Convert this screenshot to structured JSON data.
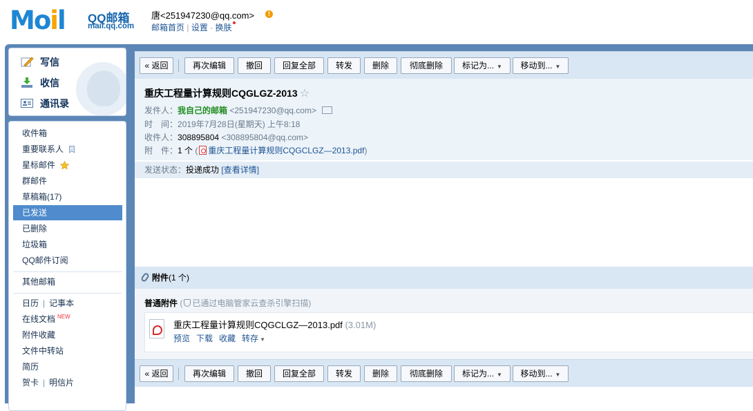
{
  "header": {
    "logo_text_m": "M",
    "logo_text_o": "o",
    "logo_text_i": "i",
    "logo_text_l": "l",
    "logo_cn": "QQ邮箱",
    "logo_url": "mail.qq.com",
    "user_display": "唐<251947230@qq.com>",
    "warn_symbol": "!",
    "links": {
      "home": "邮箱首页",
      "settings": "设置",
      "skin": "换肤"
    },
    "link_sep": "|",
    "link_dash": "-"
  },
  "sidebar": {
    "commands": {
      "compose": "写信",
      "inbox": "收信",
      "contacts": "通讯录"
    },
    "folders": {
      "inbox": "收件箱",
      "important": "重要联系人",
      "starred": "星标邮件",
      "group": "群邮件",
      "drafts": "草稿箱(17)",
      "sent": "已发送",
      "deleted": "已删除",
      "junk": "垃圾箱",
      "subscriptions": "QQ邮件订阅",
      "other_mail": "其他邮箱",
      "calendar": "日历",
      "notes": "记事本",
      "docs": "在线文档",
      "docs_badge": "NEW",
      "attach_fav": "附件收藏",
      "transfer": "文件中转站",
      "resume": "简历",
      "cards": "贺卡",
      "postcards": "明信片",
      "pipe": "|",
      "selected": "已发送"
    }
  },
  "toolbar": {
    "back": "« 返回",
    "reedit": "再次编辑",
    "recall": "撤回",
    "reply_all": "回复全部",
    "forward": "转发",
    "delete": "删除",
    "delete_perm": "彻底删除",
    "mark_as": "标记为...",
    "move_to": "移动到...",
    "dropdown_arrow": "▼"
  },
  "mail": {
    "subject": "重庆工程量计算规则CQGLGZ-2013",
    "star_glyph": "☆",
    "from_label": "发件人：",
    "from_name": "我自己的邮箱",
    "from_addr": "<251947230@qq.com>",
    "time_label": "时　间：",
    "time_value": "2019年7月28日(星期天) 上午8:18",
    "to_label": "收件人：",
    "to_name": "308895804",
    "to_addr": "<308895804@qq.com>",
    "att_label": "附　件：",
    "att_count": "1 个",
    "att_paren_open": "(",
    "att_paren_close": ")",
    "att_link": "重庆工程量计算规则CQGCLGZ—2013.pdf",
    "status_label": "发送状态：",
    "status_value": "投递成功",
    "status_detail": "[查看详情]"
  },
  "attachments": {
    "title": "附件",
    "count": "(1 个)",
    "type_label": "普通附件",
    "scan_prefix": "(",
    "scan_text": "已通过电脑管家云查杀引擎扫描)",
    "file_name": "重庆工程量计算规则CQGCLGZ—2013.pdf",
    "file_size": "(3.01M)",
    "ops": {
      "preview": "预览",
      "download": "下载",
      "collect": "收藏",
      "save": "转存"
    },
    "dropdown_arrow": "▼"
  }
}
